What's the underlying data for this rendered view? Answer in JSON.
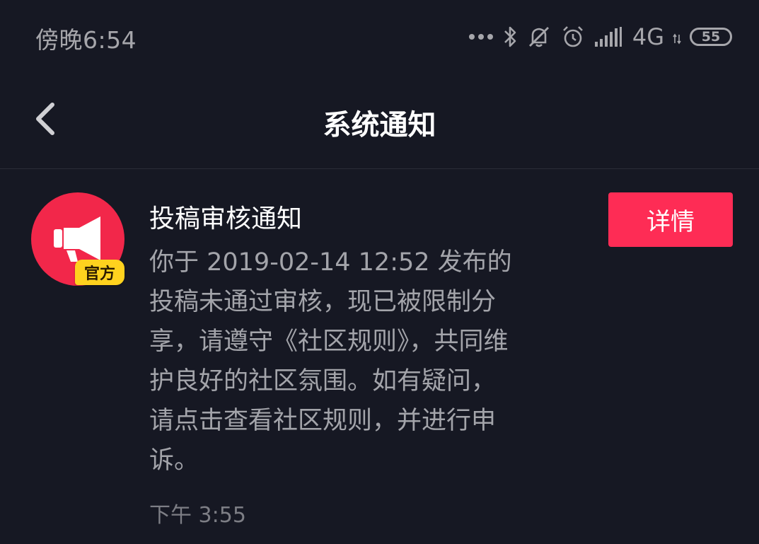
{
  "status_bar": {
    "time": "傍晚6:54",
    "network": "4G",
    "battery": "55",
    "icons": [
      "more-dots-icon",
      "bluetooth-icon",
      "mute-icon",
      "alarm-icon",
      "signal-icon",
      "data-arrows-icon",
      "battery-icon"
    ]
  },
  "header": {
    "title": "系统通知",
    "back_icon": "chevron-left-icon"
  },
  "notification": {
    "avatar_icon": "megaphone-icon",
    "badge": "官方",
    "title": "投稿审核通知",
    "body_lines": [
      "你于 2019-02-14 12:52 发布的",
      "投稿未通过审核，现已被限制分",
      "享，请遵守《社区规则》，共同维",
      "护良好的社区氛围。如有疑问，",
      "请点击查看社区规则，并进行申",
      "诉。"
    ],
    "time": "下午 3:55",
    "detail_label": "详情"
  },
  "colors": {
    "background": "#161823",
    "accent": "#fe2c55",
    "avatar": "#f2274a",
    "badge": "#ffd21e",
    "secondary_text": "#a3a4aa"
  }
}
